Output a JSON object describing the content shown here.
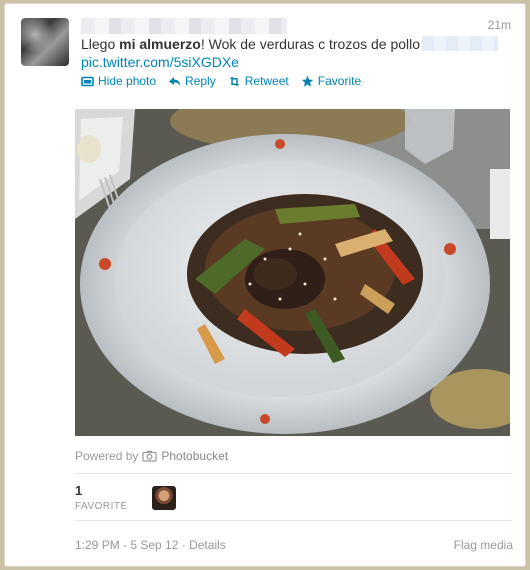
{
  "tweet": {
    "time": "21m",
    "text_before": "Llego ",
    "text_bold": "mi almuerzo",
    "text_after": "! Wok de verduras c trozos de pollo",
    "link": "pic.twitter.com/5siXGDXe"
  },
  "actions": {
    "hide_photo": "Hide photo",
    "reply": "Reply",
    "retweet": "Retweet",
    "favorite": "Favorite"
  },
  "media": {
    "powered_by": "Powered by",
    "provider": "Photobucket"
  },
  "stats": {
    "favorite_count": "1",
    "favorite_label": "FAVORITE"
  },
  "footer": {
    "timestamp": "1:29 PM - 5 Sep 12",
    "separator": "·",
    "details": "Details",
    "flag_media": "Flag media"
  },
  "colors": {
    "link": "#0084b4",
    "muted": "#999999",
    "text": "#333333"
  }
}
